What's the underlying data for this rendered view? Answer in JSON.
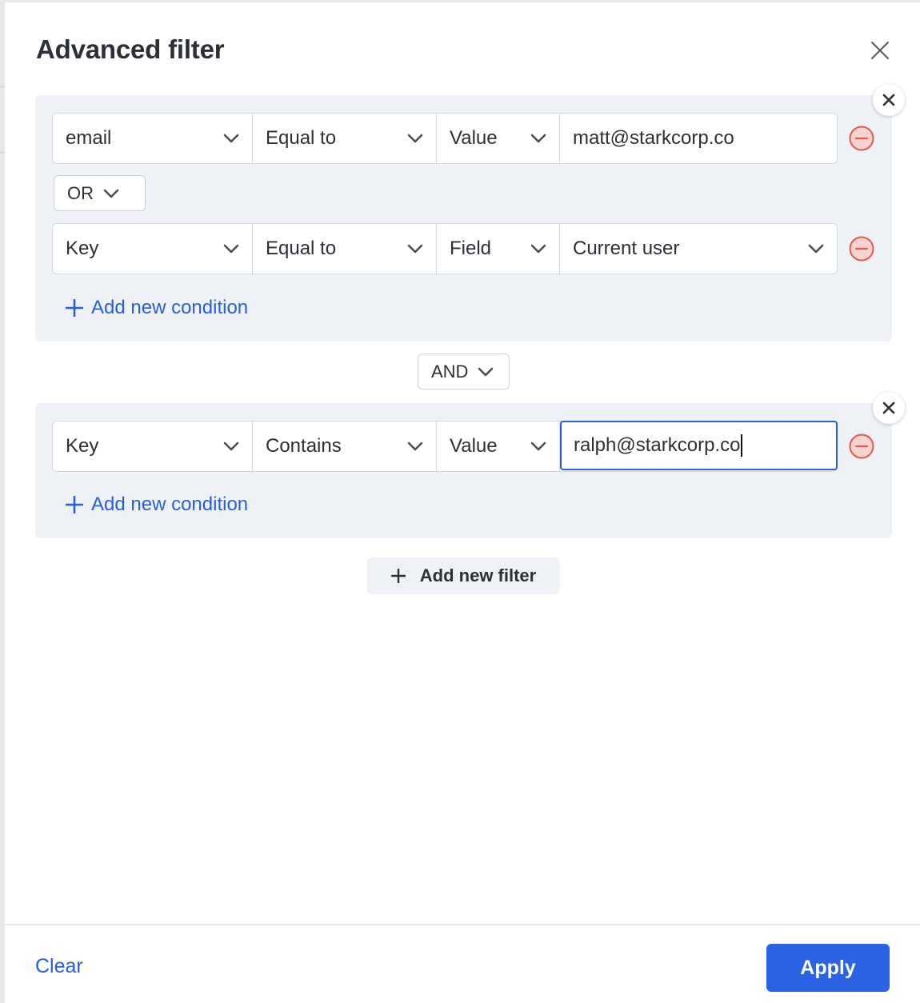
{
  "modal": {
    "title": "Advanced filter"
  },
  "filters": [
    {
      "conditions": [
        {
          "field": "email",
          "operator": "Equal to",
          "type": "Value",
          "value": "matt@starkcorp.co"
        },
        {
          "field": "Key",
          "operator": "Equal to",
          "type": "Field",
          "value": "Current user"
        }
      ],
      "condition_join": "OR",
      "add_condition_label": "Add new condition"
    },
    {
      "conditions": [
        {
          "field": "Key",
          "operator": "Contains",
          "type": "Value",
          "value": "ralph@starkcorp.co"
        }
      ],
      "add_condition_label": "Add new condition"
    }
  ],
  "filter_join": "AND",
  "add_filter_label": "Add new filter",
  "footer": {
    "clear_label": "Clear",
    "apply_label": "Apply"
  },
  "colors": {
    "accent": "#2a63e4",
    "link": "#2760d6",
    "group_bg": "#eef1f6",
    "remove_red": "#e05a4f",
    "focus_border": "#2d5fd3"
  },
  "icons": {
    "close": "close-icon",
    "chevron": "chevron-down-icon",
    "remove": "minus-circle-icon",
    "plus": "plus-icon"
  }
}
